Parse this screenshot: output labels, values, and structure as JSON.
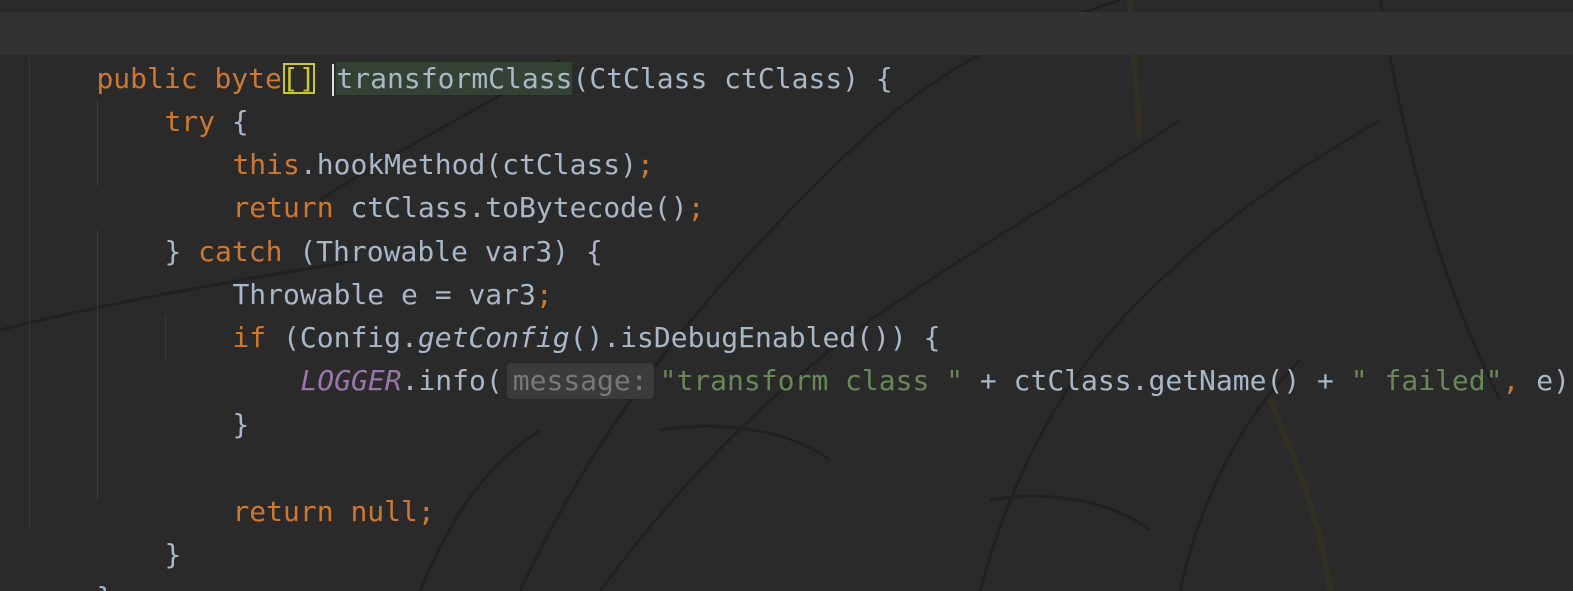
{
  "editor": {
    "lines": [
      {
        "t1": "public byte",
        "t2": "[]",
        "t3": "transformClass",
        "t4": "(CtClass ctClass) {"
      },
      {
        "t1": "try",
        "t2": " {"
      },
      {
        "t1": "this",
        "t2": ".hookMethod(ctClass)",
        "t3": ";"
      },
      {
        "t1": "return",
        "t2": " ctClass.toBytecode()",
        "t3": ";"
      },
      {
        "t1": "} ",
        "t2": "catch",
        "t3": " (Throwable var3) {"
      },
      {
        "t1": "Throwable e = var3",
        "t2": ";"
      },
      {
        "t1": "if",
        "t2": " (Config.",
        "t3": "getConfig",
        "t4": "().isDebugEnabled()) {"
      },
      {
        "t1": "LOGGER",
        "t2": ".info(",
        "hint": "message:",
        "t3": "\"transform class \"",
        "t4": " + ctClass.getName() + ",
        "t5": "\" failed\"",
        "t6": ",",
        "t7": " e)",
        "t8": ";"
      },
      {
        "t1": "}"
      },
      {
        "t1": "return null",
        "t2": ";"
      },
      {
        "t1": "}"
      },
      {
        "t1": "}"
      }
    ]
  },
  "colors": {
    "background": "#2b2b2b",
    "keyword": "#cc7832",
    "string": "#6a8759",
    "plain": "#a9b7c6",
    "static_field": "#9876aa"
  }
}
